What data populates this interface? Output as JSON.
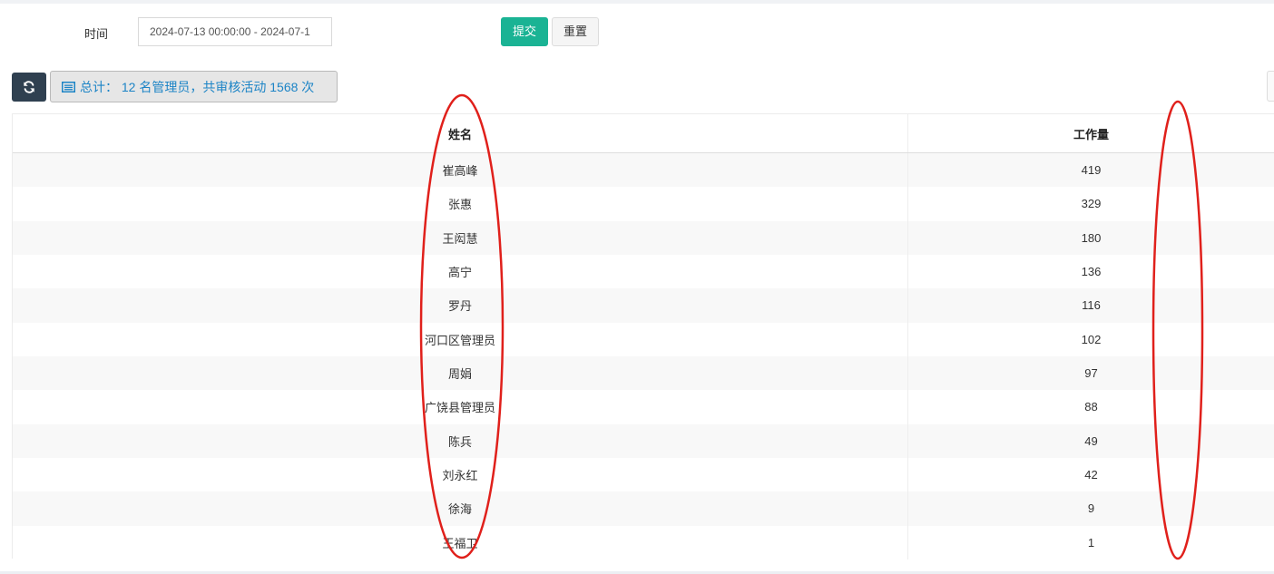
{
  "filter": {
    "time_label": "时间",
    "date_range_value": "2024-07-13 00:00:00 - 2024-07-1",
    "submit_label": "提交",
    "reset_label": "重置"
  },
  "toolbar": {
    "refresh_icon": "refresh-icon",
    "summary_icon": "list-icon",
    "summary_text": "总计： 12 名管理员，共审核活动 1568 次"
  },
  "table": {
    "columns": [
      "姓名",
      "工作量"
    ],
    "rows": [
      {
        "name": "崔高峰",
        "workload": "419"
      },
      {
        "name": "张惠",
        "workload": "329"
      },
      {
        "name": "王闳慧",
        "workload": "180"
      },
      {
        "name": "高宁",
        "workload": "136"
      },
      {
        "name": "罗丹",
        "workload": "116"
      },
      {
        "name": "河口区管理员",
        "workload": "102"
      },
      {
        "name": "周娟",
        "workload": "97"
      },
      {
        "name": "广饶县管理员",
        "workload": "88"
      },
      {
        "name": "陈兵",
        "workload": "49"
      },
      {
        "name": "刘永红",
        "workload": "42"
      },
      {
        "name": "徐海",
        "workload": "9"
      },
      {
        "name": "王福卫",
        "workload": "1"
      }
    ]
  },
  "colors": {
    "submit_bg": "#1ab394",
    "refresh_bg": "#2f4050",
    "summary_text": "#1c84c6",
    "annotation_ellipse": "#e0201b"
  }
}
